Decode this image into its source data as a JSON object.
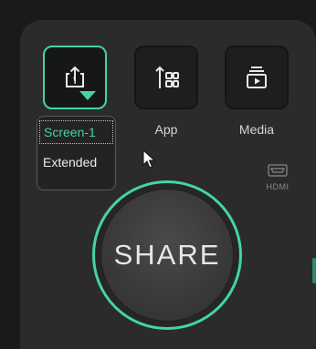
{
  "tiles": {
    "screen": {
      "icon": "screen-share-icon",
      "selected": true
    },
    "app": {
      "icon": "app-grid-icon",
      "label": "App"
    },
    "media": {
      "icon": "media-play-icon",
      "label": "Media"
    }
  },
  "dropdown": {
    "items": [
      {
        "label": "Screen-1",
        "active": true
      },
      {
        "label": "Extended",
        "active": false
      }
    ]
  },
  "hdmi": {
    "label": "HDMI",
    "icon": "hdmi-port-icon"
  },
  "share_button": {
    "label": "SHARE"
  },
  "colors": {
    "accent": "#45d4a4",
    "panel": "#2b2b2b",
    "background": "#1a1a1a"
  }
}
